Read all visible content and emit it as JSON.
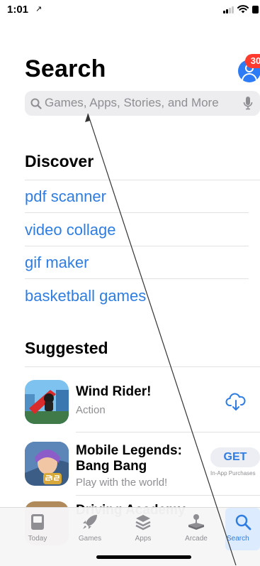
{
  "status_bar": {
    "time": "1:01",
    "arrow": "↗"
  },
  "header": {
    "title": "Search",
    "badge_count": "30"
  },
  "search": {
    "placeholder": "Games, Apps, Stories, and More"
  },
  "discover": {
    "title": "Discover",
    "items": [
      "pdf scanner",
      "video collage",
      "gif maker",
      "basketball games"
    ]
  },
  "suggested": {
    "title": "Suggested",
    "apps": [
      {
        "name": "Wind Rider!",
        "subtitle": "Action",
        "action": "cloud-download"
      },
      {
        "name_line1": "Mobile Legends:",
        "name_line2": "Bang Bang",
        "subtitle": "Play with the world!",
        "button": "GET",
        "note": "In-App Purchases"
      },
      {
        "name_partial": "Driving Academy"
      }
    ]
  },
  "tabs": [
    {
      "label": "Today",
      "icon": "today-icon"
    },
    {
      "label": "Games",
      "icon": "rocket-icon"
    },
    {
      "label": "Apps",
      "icon": "layers-icon"
    },
    {
      "label": "Arcade",
      "icon": "joystick-icon"
    },
    {
      "label": "Search",
      "icon": "search-icon",
      "active": true
    }
  ],
  "colors": {
    "accent": "#2f7de1",
    "badge": "#ff3b30",
    "avatar": "#2d7cf6"
  }
}
